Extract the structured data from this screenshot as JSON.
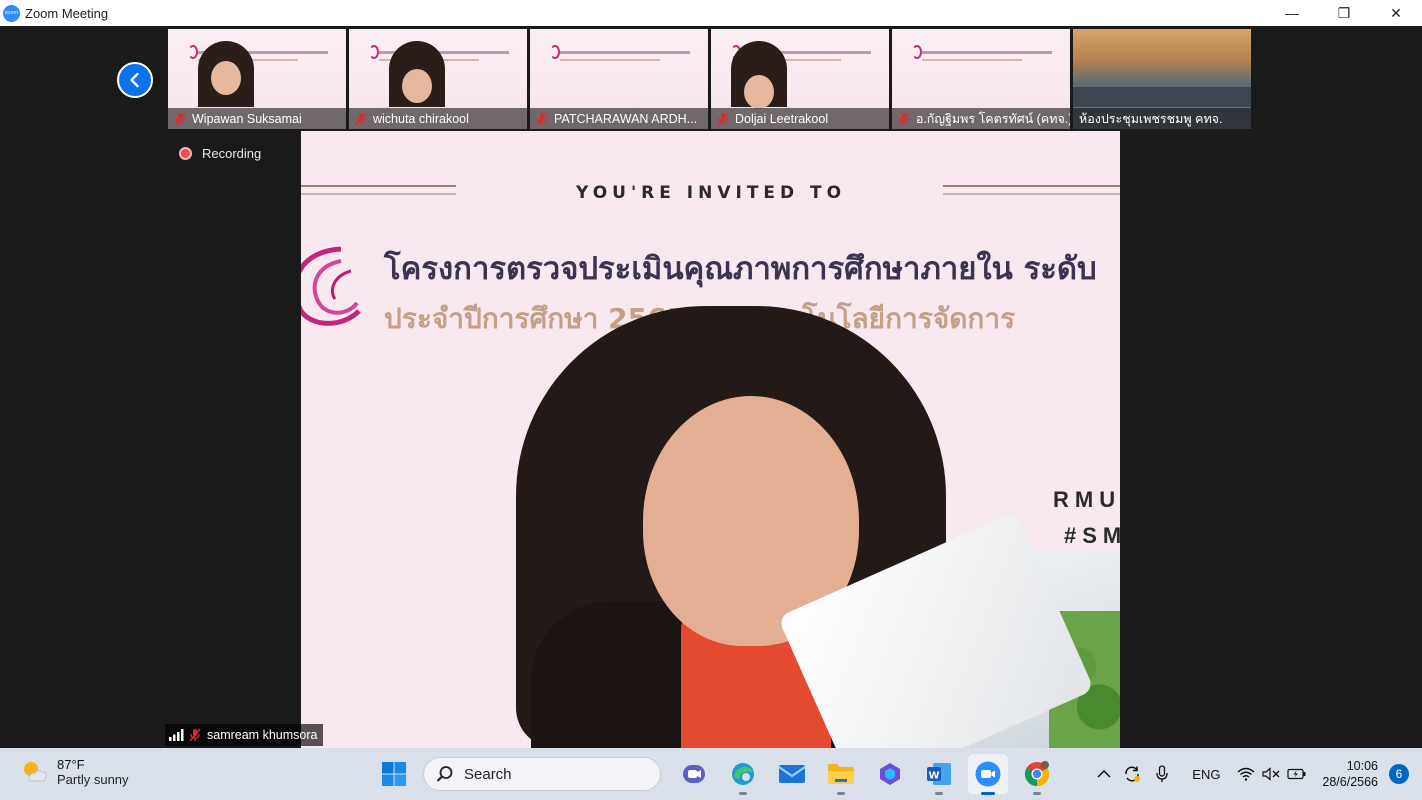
{
  "window": {
    "title": "Zoom Meeting",
    "logo_text": "zoom",
    "controls": {
      "minimize": "—",
      "restore": "❐",
      "close": "✕"
    }
  },
  "recording": {
    "label": "Recording"
  },
  "participants": [
    {
      "name": "Wipawan Suksamai",
      "muted": true
    },
    {
      "name": "wichuta chirakool",
      "muted": true
    },
    {
      "name": "PATCHARAWAN ARDH...",
      "muted": true
    },
    {
      "name": "Doljai Leetrakool",
      "muted": true
    },
    {
      "name": "อ.กัญฐิมพร  โคตรทัศน์ (คทจ.)",
      "muted": true
    },
    {
      "name": "ห้องประชุมเพชรชมพู คทจ.",
      "muted": false
    }
  ],
  "main_video": {
    "speaker_name": "samream khumsora",
    "slide": {
      "invited": "YOU'RE INVITED TO",
      "title_line1": "โครงการตรวจประเมินคุณภาพการศึกษาภายใน ระดับ",
      "title_line2": "ประจำปีการศึกษา 2565 คณะเทคโนโลยีการจัดการ",
      "tag1": "RMU",
      "tag2": "#SM"
    }
  },
  "taskbar": {
    "weather": {
      "temp": "87°F",
      "condition": "Partly sunny"
    },
    "search_label": "Search",
    "language": "ENG",
    "time": "10:06",
    "date": "28/6/2566",
    "notifications": "6"
  },
  "colors": {
    "zoom_blue": "#2d8cff",
    "back_button": "#0e72ed",
    "recording_red": "#e94e4e",
    "muted_red": "#e02828",
    "taskbar_bg": "#d9e0ea"
  }
}
